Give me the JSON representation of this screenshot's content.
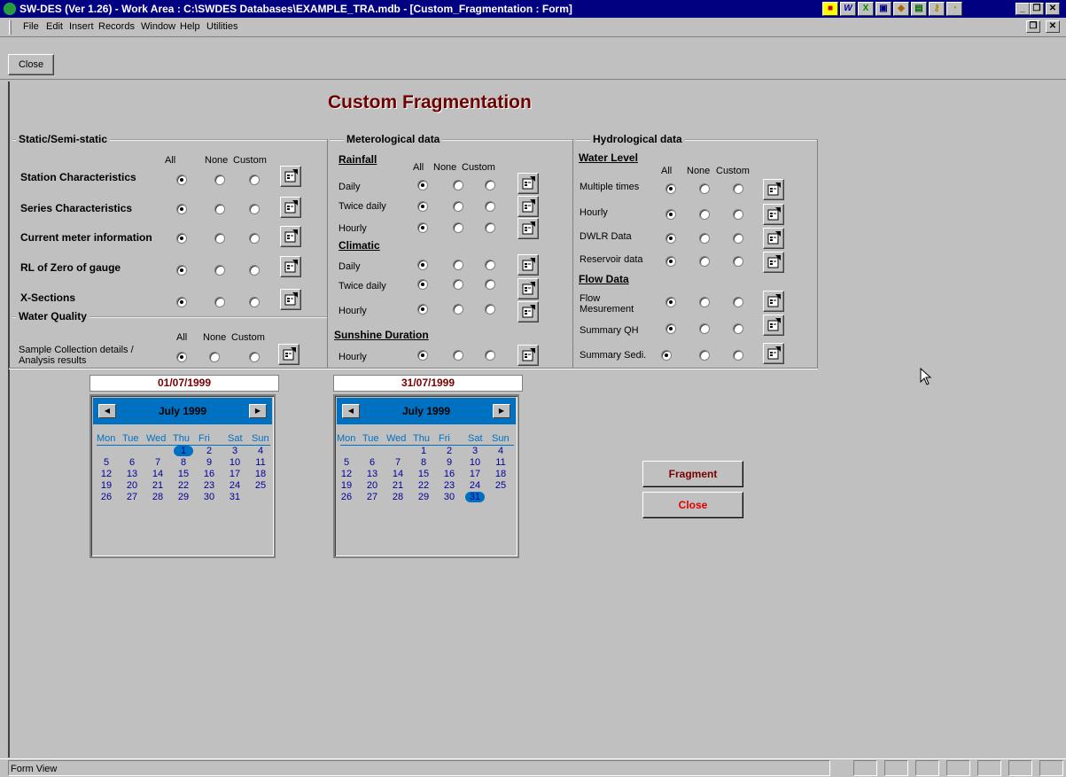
{
  "window": {
    "title": "SW-DES (Ver 1.26) - Work Area : C:\\SWDES Databases\\EXAMPLE_TRA.mdb - [Custom_Fragmentation : Form]"
  },
  "menubar": [
    {
      "label": "File"
    },
    {
      "label": "Edit"
    },
    {
      "label": "Insert"
    },
    {
      "label": "Records"
    },
    {
      "label": "Window"
    },
    {
      "label": "Help"
    },
    {
      "label": "Utilities"
    }
  ],
  "toolbar": {
    "close_label": "Close"
  },
  "form": {
    "title": "Custom Fragmentation"
  },
  "columns": {
    "all": "All",
    "none": "None",
    "custom": "Custom"
  },
  "static": {
    "title": "Static/Semi-static",
    "rows": [
      {
        "label": "Station Characteristics"
      },
      {
        "label": "Series Characteristics"
      },
      {
        "label": "Current meter information"
      },
      {
        "label": "RL of Zero of gauge"
      },
      {
        "label": "X-Sections"
      }
    ]
  },
  "water_quality": {
    "title": "Water Quality",
    "row_label_1": "Sample Collection details /",
    "row_label_2": "Analysis results"
  },
  "met": {
    "title": "Meterological data",
    "rainfall": "Rainfall",
    "climatic": "Climatic",
    "sunshine": "Sunshine Duration",
    "rainfall_rows": [
      "Daily",
      "Twice daily",
      "Hourly"
    ],
    "climatic_rows": [
      "Daily",
      "Twice daily",
      "Hourly"
    ],
    "sunshine_rows": [
      "Hourly"
    ]
  },
  "hydro": {
    "title": "Hydrological data",
    "water_level": "Water Level",
    "flow_data": "Flow Data",
    "wl_rows": [
      "Multiple times",
      "Hourly",
      "DWLR Data",
      "Reservoir data"
    ],
    "flow_rows": [
      "Flow",
      "Mesurement",
      "Summary QH",
      "Summary Sedi."
    ]
  },
  "calendars": [
    {
      "date_value": "01/07/1999",
      "month": "July 1999",
      "selected_day": "1"
    },
    {
      "date_value": "31/07/1999",
      "month": "July 1999",
      "selected_day": "31"
    }
  ],
  "calendar_dow": [
    "Mon",
    "Tue",
    "Wed",
    "Thu",
    "Fri",
    "Sat",
    "Sun"
  ],
  "actions": {
    "fragment_label": "Fragment",
    "close_label": "Close"
  },
  "statusbar": {
    "text": "Form View"
  },
  "colors": {
    "title_bar": "#000080",
    "form_title": "#6e0000",
    "calendar_header": "#0070c0",
    "fragment_text": "#7a0000",
    "close_text": "#e00000"
  }
}
